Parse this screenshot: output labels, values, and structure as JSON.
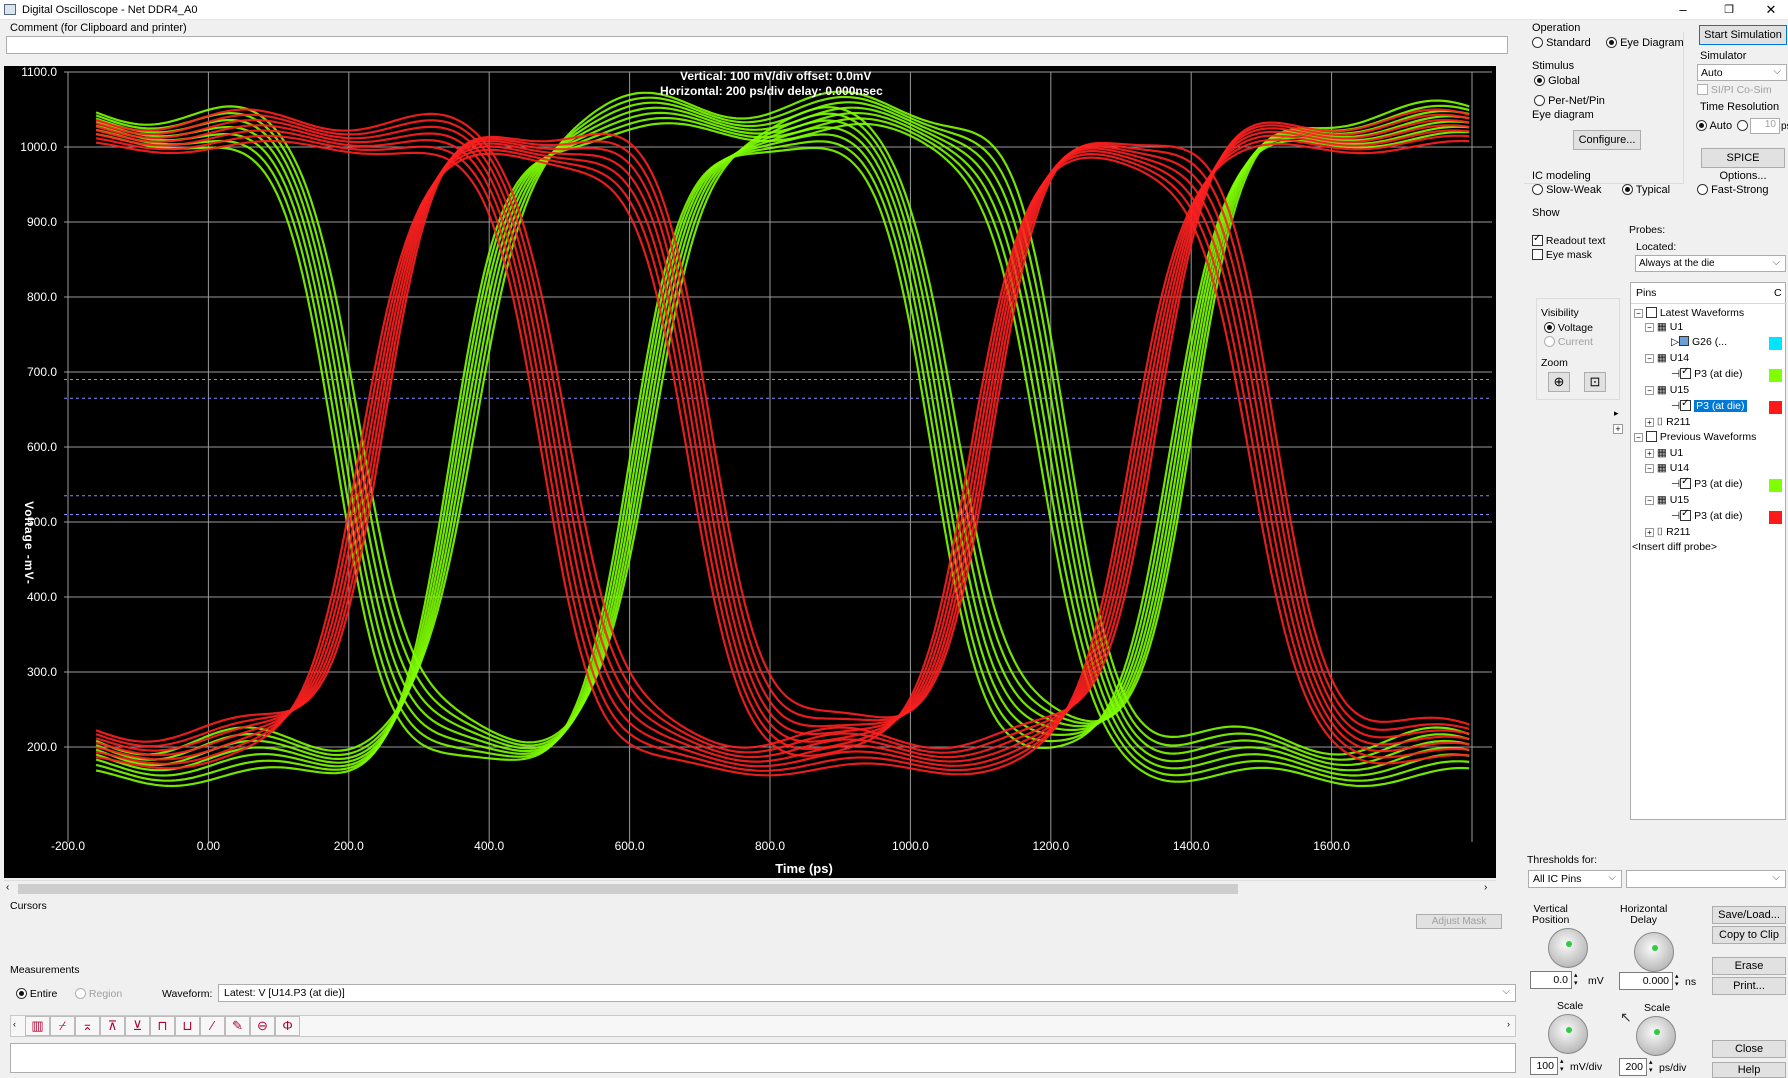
{
  "window": {
    "title": "Digital Oscilloscope - Net DDR4_A0",
    "minimize": "–",
    "restore": "❐",
    "close": "✕"
  },
  "comment": {
    "label": "Comment (for Clipboard and printer)",
    "value": ""
  },
  "plot": {
    "readout_vertical": "Vertical: 100 mV/div  offset: 0.0mV",
    "readout_horizontal": "Horizontal: 200 ps/div  delay: 0.000nsec",
    "ylabel": "Voltage  -mV-",
    "xlabel": "Time  (ps)",
    "y_ticks": [
      "1100.0",
      "1000.0",
      "900.0",
      "800.0",
      "700.0",
      "600.0",
      "500.0",
      "400.0",
      "300.0",
      "200.0"
    ],
    "x_ticks": [
      "-200.0",
      "0.00",
      "200.0",
      "400.0",
      "600.0",
      "800.0",
      "1000.0",
      "1200.0",
      "1400.0",
      "1600.0"
    ]
  },
  "chart_data": {
    "type": "line",
    "title": "",
    "xlabel": "Time  (ps)",
    "ylabel": "Voltage  -mV-",
    "xlim": [
      -200,
      1800
    ],
    "ylim": [
      100,
      1100
    ],
    "grid": true,
    "series": [
      {
        "color": "#7fff00",
        "x": [
          -160,
          0,
          200,
          365,
          560,
          900,
          1150,
          1385,
          1800
        ],
        "y": [
          160,
          150,
          300,
          520,
          930,
          1000,
          620,
          920,
          1010
        ]
      },
      {
        "color": "#ff2020",
        "x": [
          -160,
          0,
          200,
          495,
          640,
          900,
          1150,
          1330,
          1800
        ],
        "y": [
          900,
          1000,
          1030,
          520,
          280,
          200,
          300,
          520,
          970
        ]
      }
    ],
    "threshold_lines_mV": [
      690,
      665,
      535,
      510
    ]
  },
  "operation": {
    "title": "Operation",
    "standard": "Standard",
    "eye": "Eye Diagram"
  },
  "start_simulation": "Start Simulation",
  "simulator": {
    "title": "Simulator",
    "value": "Auto",
    "sipi": "SI/PI Co-Sim"
  },
  "stimulus": {
    "title": "Stimulus",
    "global": "Global",
    "per_net": "Per-Net/Pin",
    "eye_title": "Eye diagram",
    "configure": "Configure..."
  },
  "time_resolution": {
    "title": "Time Resolution",
    "auto": "Auto",
    "value": "10",
    "unit": "ps"
  },
  "spice_options": "SPICE Options...",
  "ic_modeling": {
    "title": "IC modeling",
    "slow": "Slow-Weak",
    "typical": "Typical",
    "fast": "Fast-Strong"
  },
  "show": {
    "title": "Show",
    "readout": "Readout text",
    "eye_mask": "Eye mask"
  },
  "probes": {
    "title": "Probes:",
    "located_label": "Located:",
    "located_value": "Always at the die"
  },
  "visibility": {
    "title": "Visibility",
    "voltage": "Voltage",
    "current": "Current"
  },
  "zoom": {
    "title": "Zoom"
  },
  "pins": {
    "header": "Pins",
    "header_c": "C",
    "latest": "Latest Waveforms",
    "previous": "Previous Waveforms",
    "u1": "U1",
    "u14": "U14",
    "u15": "U15",
    "r211": "R211",
    "g26": "G26 (...",
    "p3": "P3 (at die)",
    "insert": "<Insert diff probe>",
    "colors": {
      "cyan": "#00e5ff",
      "green": "#7fff00",
      "red": "#ff1a1a"
    }
  },
  "thresholds": {
    "title": "Thresholds for:",
    "value": "All IC Pins"
  },
  "cursors": {
    "title": "Cursors",
    "adjust_mask": "Adjust Mask"
  },
  "measurements": {
    "title": "Measurements",
    "entire": "Entire",
    "region": "Region",
    "waveform_label": "Waveform:",
    "waveform_value": "Latest: V [U14.P3 (at die)]"
  },
  "vertical": {
    "title": "Vertical\nPosition",
    "value": "0.0",
    "unit": "mV",
    "scale_title": "Scale",
    "scale_value": "100",
    "scale_unit": "mV/div"
  },
  "horizontal": {
    "title": "Horizontal\nDelay",
    "value": "0.000",
    "unit": "ns",
    "scale_title": "Scale",
    "scale_value": "200",
    "scale_unit": "ps/div"
  },
  "buttons": {
    "save_load": "Save/Load...",
    "copy_clip": "Copy to Clip",
    "erase": "Erase",
    "print": "Print...",
    "close": "Close",
    "help": "Help"
  },
  "tool_icons": [
    "eye-measure-icon",
    "rise-time-icon",
    "fall-time-icon",
    "overshoot-icon",
    "undershoot-icon",
    "setup-icon",
    "hold-icon",
    "slew-icon",
    "probe-pen-icon",
    "eye-width-icon",
    "phase-icon"
  ]
}
